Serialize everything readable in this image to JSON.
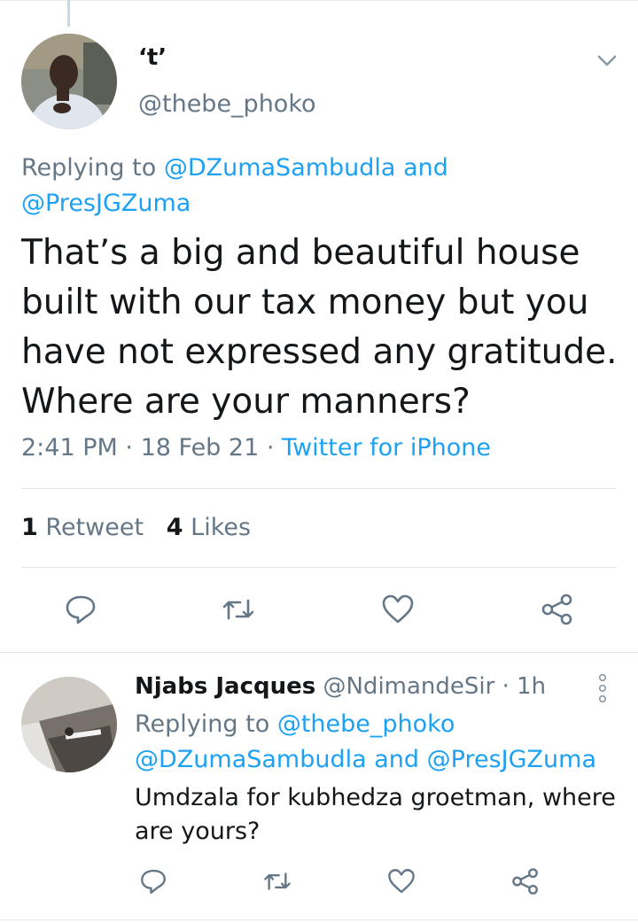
{
  "tweet": {
    "display_name": "‘t’",
    "handle": "@thebe_phoko",
    "replying_prefix": "Replying to",
    "replying_mention_1": "@DZumaSambudla",
    "replying_and": "and",
    "replying_mention_2": "@PresJGZuma",
    "text": "That’s a big and beautiful house built with our tax money but you have not expressed any gratitude. Where are your manners?",
    "time": "2:41 PM",
    "date": "18 Feb 21",
    "separator": "·",
    "source": "Twitter for iPhone",
    "retweet_count": "1",
    "retweet_label": "Retweet",
    "like_count": "4",
    "like_label": "Likes"
  },
  "reply": {
    "display_name": "Njabs Jacques",
    "handle": "@NdimandeSir",
    "separator": "·",
    "age": "1h",
    "replying_prefix": "Replying to",
    "replying_mention_1": "@thebe_phoko",
    "replying_mention_2": "@DZumaSambudla",
    "replying_and": "and",
    "replying_mention_3": "@PresJGZuma",
    "text": "Umdzala for kubhedza groetman, where are yours?"
  },
  "icons": {
    "accent": "#1da1f2",
    "muted": "#657786",
    "names": [
      "chevron-down-icon",
      "reply-icon",
      "retweet-icon",
      "like-icon",
      "share-icon",
      "more-vertical-icon"
    ]
  }
}
